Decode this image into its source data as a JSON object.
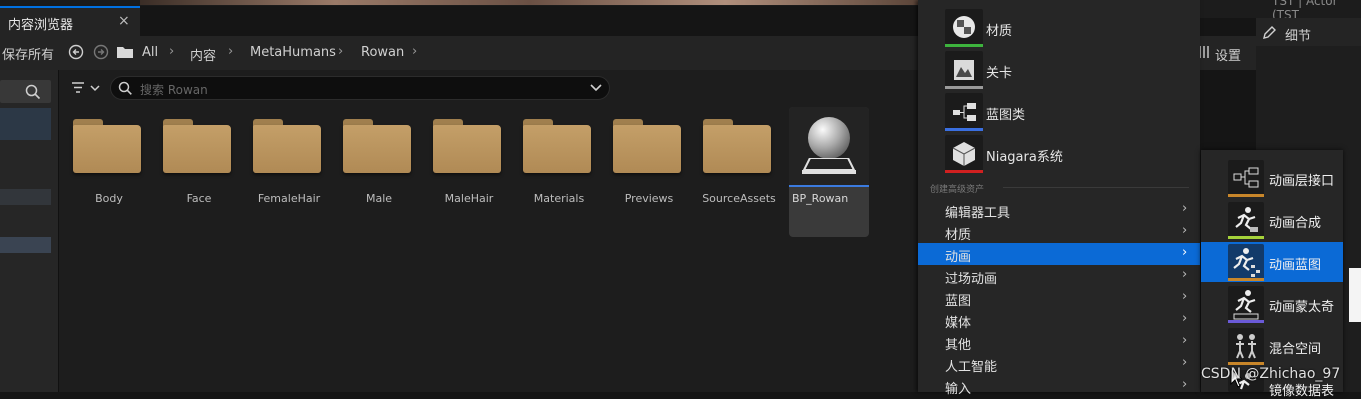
{
  "tab": {
    "title": "内容浏览器",
    "close": "×"
  },
  "toolbar": {
    "save_all": "保存所有",
    "settings": "设置"
  },
  "breadcrumb": [
    "All",
    "内容",
    "MetaHumans",
    "Rowan"
  ],
  "search": {
    "placeholder": "搜索 Rowan"
  },
  "folders": [
    "Body",
    "Face",
    "FemaleHair",
    "Male",
    "MaleHair",
    "Materials",
    "Previews",
    "SourceAssets"
  ],
  "asset": {
    "name": "BP_Rowan"
  },
  "details": {
    "title": "细节",
    "top_text": "TST | Actor (TST"
  },
  "menu": {
    "quick_items": [
      {
        "label": "材质",
        "color": "#3db33d"
      },
      {
        "label": "关卡",
        "color": "#9a9a9a"
      },
      {
        "label": "蓝图类",
        "color": "#3a6fe0"
      },
      {
        "label": "Niagara系统",
        "color": "#d02020"
      }
    ],
    "section_label": "创建高级资产",
    "items": [
      "编辑器工具",
      "材质",
      "动画",
      "过场动画",
      "蓝图",
      "媒体",
      "其他",
      "人工智能",
      "输入"
    ],
    "selected_index": 2
  },
  "submenu": {
    "items": [
      {
        "label": "动画层接口",
        "color": "#c8862a"
      },
      {
        "label": "动画合成",
        "color": "#a5d23a"
      },
      {
        "label": "动画蓝图",
        "color": "#c8862a"
      },
      {
        "label": "动画蒙太奇",
        "color": "#6a5ad8"
      },
      {
        "label": "混合空间",
        "color": "#c8862a"
      },
      {
        "label": "镜像数据表",
        "color": "#c8862a"
      }
    ],
    "selected_index": 2
  },
  "watermark": "CSDN @Zhichao_97"
}
